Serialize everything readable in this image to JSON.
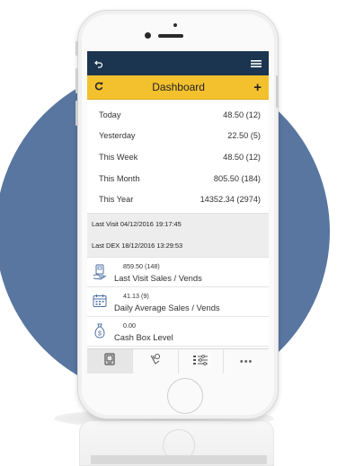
{
  "header": {
    "back_icon": "undo-arrow-icon",
    "menu_icon": "hamburger-menu-icon"
  },
  "dashboard_bar": {
    "refresh_icon": "refresh-icon",
    "title": "Dashboard",
    "add_label": "+"
  },
  "stats": [
    {
      "period": "Today",
      "value": "48.50 (12)"
    },
    {
      "period": "Yesterday",
      "value": "22.50 (5)"
    },
    {
      "period": "This Week",
      "value": "48.50 (12)"
    },
    {
      "period": "This Month",
      "value": "805.50 (184)"
    },
    {
      "period": "This Year",
      "value": "14352.34 (2974)"
    }
  ],
  "visits": {
    "last_visit": "Last Visit  04/12/2016 19:17:45",
    "last_dex": "Last DEX  18/12/2016 13:29:53"
  },
  "cards": [
    {
      "icon": "vending-hand-icon",
      "value": "859.50 (148)",
      "label": "Last Visit Sales / Vends"
    },
    {
      "icon": "calendar-icon",
      "value": "41.13 (9)",
      "label": "Daily Average Sales / Vends"
    },
    {
      "icon": "money-bag-icon",
      "value": "0.00",
      "label": "Cash Box Level"
    }
  ],
  "tabs": [
    {
      "icon": "machine-icon",
      "active": true
    },
    {
      "icon": "coin-hand-icon",
      "active": false
    },
    {
      "icon": "settings-list-icon",
      "active": false
    },
    {
      "icon": "more-icon",
      "label": "•••",
      "active": false
    }
  ],
  "colors": {
    "background_circle": "#5876a0",
    "app_bar": "#1b3550",
    "dashboard_bar": "#f4c12e"
  }
}
